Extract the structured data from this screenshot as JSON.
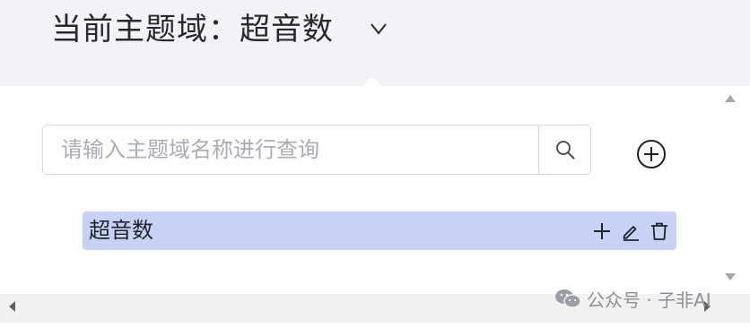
{
  "header": {
    "title": "当前主题域：超音数",
    "chevron_icon": "chevron-down-icon"
  },
  "search": {
    "placeholder": "请输入主题域名称进行查询",
    "value": "",
    "button_icon": "search-icon"
  },
  "add_domain": {
    "icon": "plus-circle-icon"
  },
  "tree": {
    "items": [
      {
        "label": "超音数",
        "selected": true,
        "actions": [
          "plus-icon",
          "edit-icon",
          "trash-icon"
        ]
      }
    ]
  },
  "scrollbars": {
    "vertical": [
      "scroll-up-arrow",
      "scroll-down-arrow"
    ],
    "horizontal": [
      "scroll-left-arrow",
      "scroll-right-arrow"
    ]
  },
  "watermark": {
    "text": "公众号 · 子非AI",
    "icon": "wechat-icon"
  },
  "colors": {
    "header_bg": "#f2f3f6",
    "selected_row_bg": "#c7d2f5",
    "input_border": "#d5d8de",
    "placeholder": "#a9adb5",
    "text": "#1f2329"
  }
}
